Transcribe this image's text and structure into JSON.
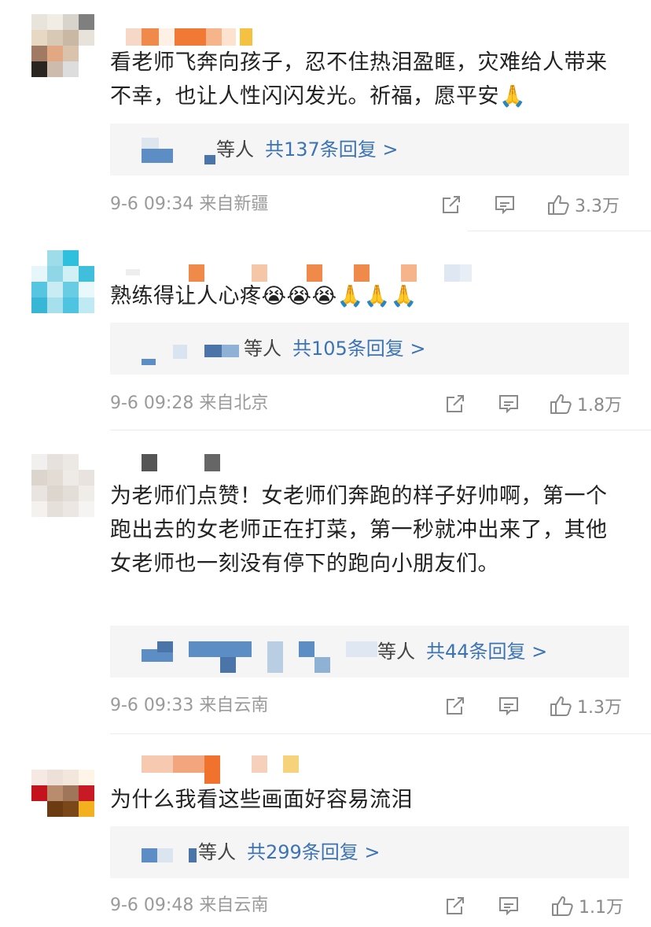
{
  "comments": [
    {
      "text": "看老师飞奔向孩子，忍不住热泪盈眶，灾难给人带来不幸，也让人性闪闪发光。祈福，愿平安🙏",
      "reply_etc": "等人",
      "reply_count": "共137条回复 >",
      "time": "9-6 09:34",
      "source": "来自新疆",
      "likes": "3.3万"
    },
    {
      "text": "熟练得让人心疼😭😭😭🙏🙏🙏",
      "reply_etc": "等人",
      "reply_count": "共105条回复 >",
      "time": "9-6 09:28",
      "source": "来自北京",
      "likes": "1.8万"
    },
    {
      "text": "为老师们点赞！女老师们奔跑的样子好帅啊，第一个跑出去的女老师正在打菜，第一秒就冲出来了，其他女老师也一刻没有停下的跑向小朋友们。",
      "reply_etc": "等人",
      "reply_count": "共44条回复 >",
      "time": "9-6 09:33",
      "source": "来自云南",
      "likes": "1.3万"
    },
    {
      "text": "为什么我看这些画面好容易流泪",
      "reply_etc": "等人",
      "reply_count": "共299条回复 >",
      "time": "9-6 09:48",
      "source": "来自云南",
      "likes": "1.1万"
    }
  ],
  "icons": {
    "share": "share-icon",
    "comment": "comment-icon",
    "like": "thumbs-up-icon"
  },
  "colors": {
    "link": "#3c73b4",
    "reply_bg": "#f5f5f5",
    "meta": "#9a9a9a"
  }
}
